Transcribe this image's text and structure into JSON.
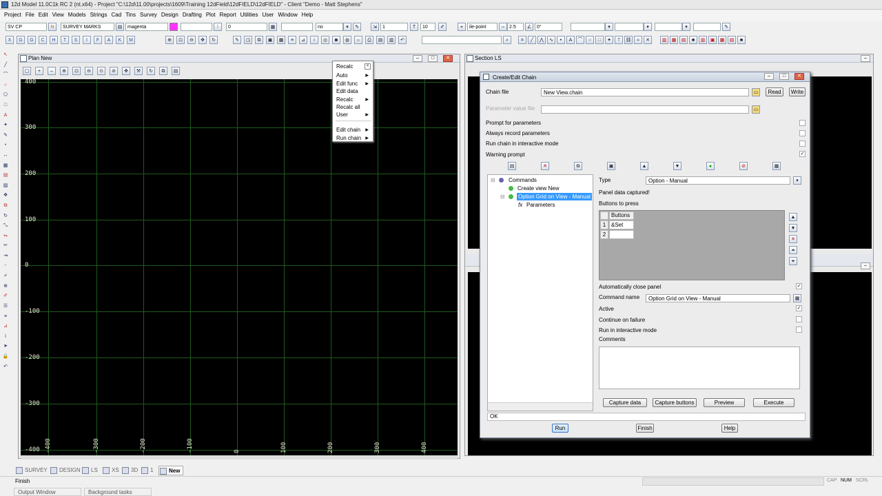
{
  "app": {
    "title": "12d Model  11.0C1k RC 2 (nt.x64) - Project \"C:\\12d\\11.00\\projects\\1609\\Training 12dField\\12dFIELD\\12dFIELD\" - Client \"Demo - Matt Stephens\""
  },
  "menubar": [
    "Project",
    "File",
    "Edit",
    "View",
    "Models",
    "Strings",
    "Cad",
    "Tins",
    "Survey",
    "Design",
    "Drafting",
    "Plot",
    "Report",
    "Utilities",
    "User",
    "Window",
    "Help"
  ],
  "toolbar": {
    "model_field": "SV CP",
    "model_btn": "N",
    "survey_marks": "SURVEY MARKS",
    "colour": "magenta",
    "colour_swatch": "#ff33ff",
    "style_value": "0",
    "text_value": "no",
    "weight_value": "1",
    "text_size": "10",
    "style_name": "ile-point",
    "scale_value": "2.5",
    "angle_value": "0°",
    "letters": [
      "X",
      "G",
      "G",
      "C",
      "H",
      "T",
      "S",
      "I",
      "F",
      "A",
      "K",
      "M"
    ]
  },
  "plan": {
    "title": "Plan New",
    "ylabels": [
      "400",
      "300",
      "200",
      "100",
      "0",
      "-100",
      "-200",
      "-300",
      "-400"
    ],
    "xlabels": [
      "-400",
      "-300",
      "-200",
      "-100",
      "0",
      "100",
      "200",
      "300",
      "400"
    ],
    "grid_color": "#1e5a1e",
    "label_color": "#e8e8d0"
  },
  "popup": {
    "title": "Recalc",
    "items": [
      {
        "label": "Auto",
        "sub": true
      },
      {
        "label": "Edit func",
        "sub": true
      },
      {
        "label": "Edit data",
        "sub": false
      },
      {
        "label": "Recalc",
        "sub": true
      },
      {
        "label": "Recalc all",
        "sub": false
      },
      {
        "label": "User",
        "sub": true
      },
      {
        "label": "Edit chain",
        "sub": true
      },
      {
        "label": "Run chain",
        "sub": true
      }
    ]
  },
  "section": {
    "title": "Section LS"
  },
  "dialog": {
    "title": "Create/Edit Chain",
    "chain_file_label": "Chain file",
    "chain_file_value": "New View.chain",
    "read_label": "Read",
    "write_label": "Write",
    "param_file_label": "Parameter value file",
    "prompt_params": "Prompt for parameters",
    "always_record": "Always record parameters",
    "run_interactive": "Run chain in interactive mode",
    "warning_prompt": "Warning prompt",
    "warning_checked": "✓",
    "tree": {
      "root": "Commands",
      "item1": "Create view New",
      "item2": "Option Grid on View - Manual",
      "item3": "Parameters"
    },
    "type_label": "Type",
    "type_value": "Option - Manual",
    "panel_captured": "Panel data captured!",
    "buttons_to_press": "Buttons to press",
    "grid_header": "Buttons",
    "grid_rows": [
      {
        "n": "1",
        "v": "&Set"
      },
      {
        "n": "2",
        "v": ""
      }
    ],
    "auto_close": "Automatically close panel",
    "auto_close_checked": "✓",
    "command_name_label": "Command name",
    "command_name_value": "Option Grid on View - Manual",
    "active_label": "Active",
    "active_checked": "✓",
    "continue_failure": "Continue on failure",
    "run_interactive2": "Run in interactive mode",
    "comments_label": "Comments",
    "capture_data": "Capture data",
    "capture_buttons": "Capture buttons",
    "preview": "Preview",
    "execute": "Execute",
    "message": "OK",
    "run": "Run",
    "finish": "Finish",
    "help": "Help"
  },
  "tabs": [
    "SURVEY",
    "DESIGN",
    "LS",
    "XS",
    "3D",
    "1",
    "New"
  ],
  "status": {
    "message": "Finish",
    "output_window": "Output Window",
    "background_tasks": "Background tasks",
    "indicators": [
      "CAP",
      "NUM",
      "SCRL"
    ]
  }
}
